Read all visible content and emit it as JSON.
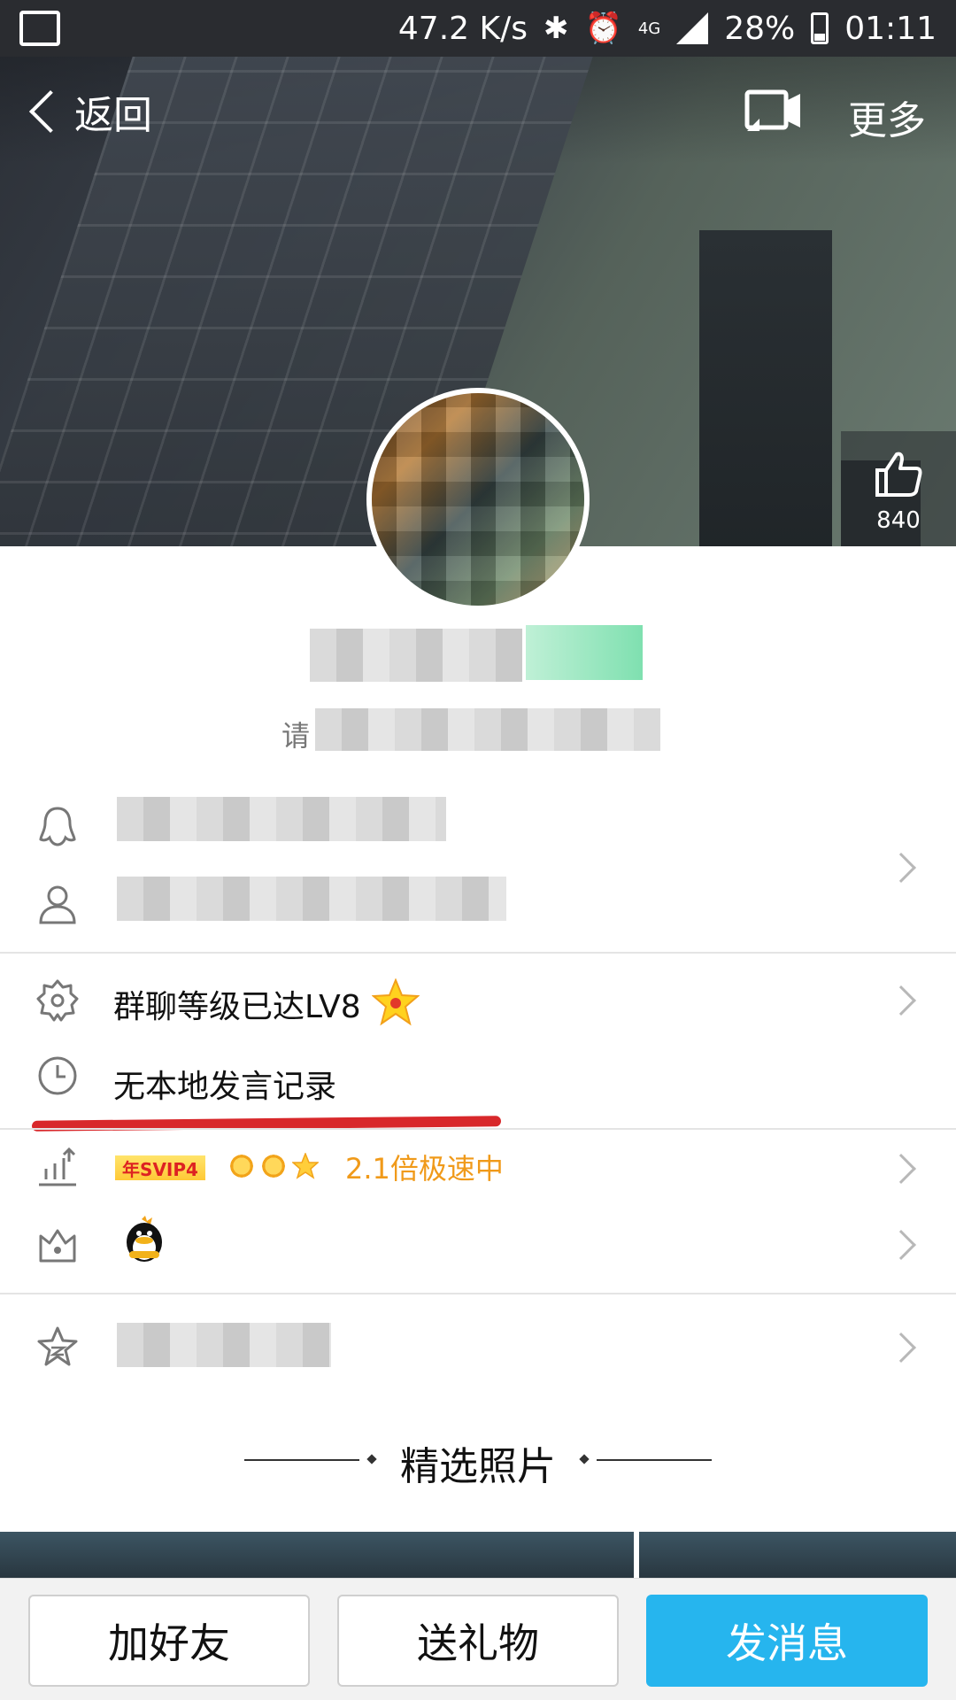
{
  "status_bar": {
    "speed": "47.2 K/s",
    "network": "4G",
    "battery": "28%",
    "time": "01:11"
  },
  "nav": {
    "back_label": "返回",
    "more_label": "更多"
  },
  "likes": {
    "count": "840"
  },
  "profile": {
    "signature_start": "请",
    "signature_end": "号?"
  },
  "rows": {
    "group_level": "群聊等级已达LV8",
    "no_local_record": "无本地发言记录",
    "svip_badge": "年SVIP4",
    "speed_text": "2.1倍极速中"
  },
  "section": {
    "featured_photos": "精选照片"
  },
  "bottom_bar": {
    "add_friend": "加好友",
    "send_gift": "送礼物",
    "send_message": "发消息"
  },
  "colors": {
    "accent_blue": "#26b5ee",
    "speed_orange": "#f09a1a",
    "highlight_red": "#d8282b"
  },
  "icons": {
    "back": "chevron-left-icon",
    "cast": "screen-cast-icon",
    "like": "thumbs-up-icon",
    "qq": "qq-penguin-icon",
    "person": "person-icon",
    "badge": "badge-star-icon",
    "clock": "clock-icon",
    "chart": "bar-chart-icon",
    "crown": "crown-icon",
    "favorite": "star-outline-icon"
  }
}
